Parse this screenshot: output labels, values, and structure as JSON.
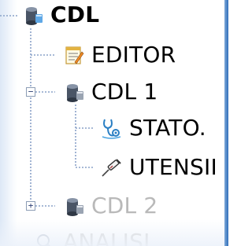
{
  "tree": {
    "nodes": [
      {
        "id": "cdl",
        "label": "CDL",
        "icon": "cdl-database-icon",
        "expander": null
      },
      {
        "id": "editor",
        "label": "EDITOR",
        "icon": "editor-notepad-icon",
        "expander": null
      },
      {
        "id": "cdl1",
        "label": "CDL 1",
        "icon": "cdl-database-icon",
        "expander": "−"
      },
      {
        "id": "stato",
        "label": "STATO.",
        "icon": "stethoscope-icon",
        "expander": null
      },
      {
        "id": "utensili",
        "label": "UTENSII",
        "icon": "syringe-tool-icon",
        "expander": null
      },
      {
        "id": "cdl2",
        "label": "CDL 2",
        "icon": "cdl-database-icon",
        "expander": "+"
      },
      {
        "id": "analisi",
        "label": "ANALISI",
        "icon": "analysis-icon",
        "expander": null
      }
    ]
  },
  "colors": {
    "tree_line": "#8aa2c8",
    "panel_border": "#2f6fba",
    "disabled_text": "#b9b9b9"
  }
}
